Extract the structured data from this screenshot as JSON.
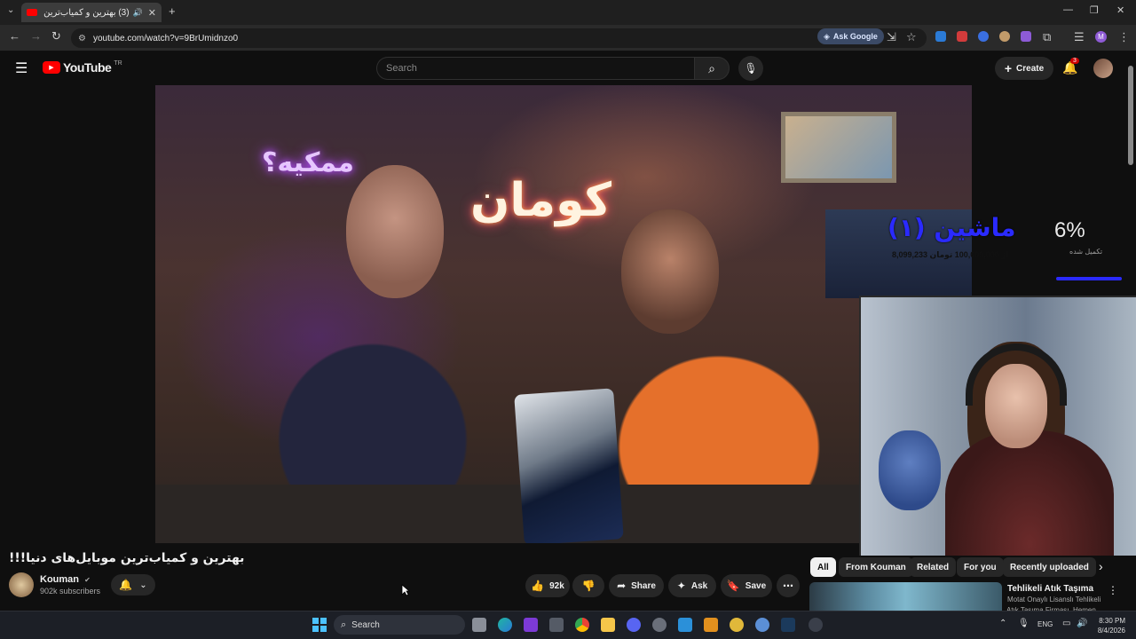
{
  "browser": {
    "tab_title": "(3) بهترین و کمیاب‌ترین موبا",
    "url": "youtube.com/watch?v=9BrUmidnzo0",
    "ask_google": "Ask Google",
    "profile_initial": "M"
  },
  "youtube": {
    "logo_text": "YouTube",
    "region": "TR",
    "search_placeholder": "Search",
    "create_label": "Create",
    "notification_count": "3"
  },
  "video_overlay": {
    "machine_title": "ماشین (۱)",
    "machine_sub": "8,099,233 از 100,000,000 تومان",
    "percent": "6%",
    "percent_label": "تکمیل شده",
    "neon_small": "ممکیه؟",
    "neon_big": "کومان"
  },
  "video": {
    "title": "بهترین و کمیاب‌ترین موبایل‌های دنیا!!!",
    "channel": "Kouman",
    "subscribers": "902k subscribers",
    "likes": "92k",
    "share_label": "Share",
    "ask_label": "Ask",
    "save_label": "Save"
  },
  "chips": [
    {
      "label": "All",
      "active": true
    },
    {
      "label": "From Kouman",
      "active": false
    },
    {
      "label": "Related",
      "active": false
    },
    {
      "label": "For you",
      "active": false
    },
    {
      "label": "Recently uploaded",
      "active": false
    }
  ],
  "recommendation": {
    "title": "Tehlikeli Atık Taşıma",
    "channel": "Motat Onaylı Lisanslı Tehlikeli",
    "more": "Atık Taşıma Firması. Hemen"
  },
  "taskbar": {
    "search_label": "Search",
    "language": "ENG",
    "time": "8:30 PM",
    "date": "8/4/2026"
  },
  "colors": {
    "youtube_red": "#ff0000",
    "accent_blue": "#3ea6ff",
    "overlay_blue": "#2a2aff"
  }
}
